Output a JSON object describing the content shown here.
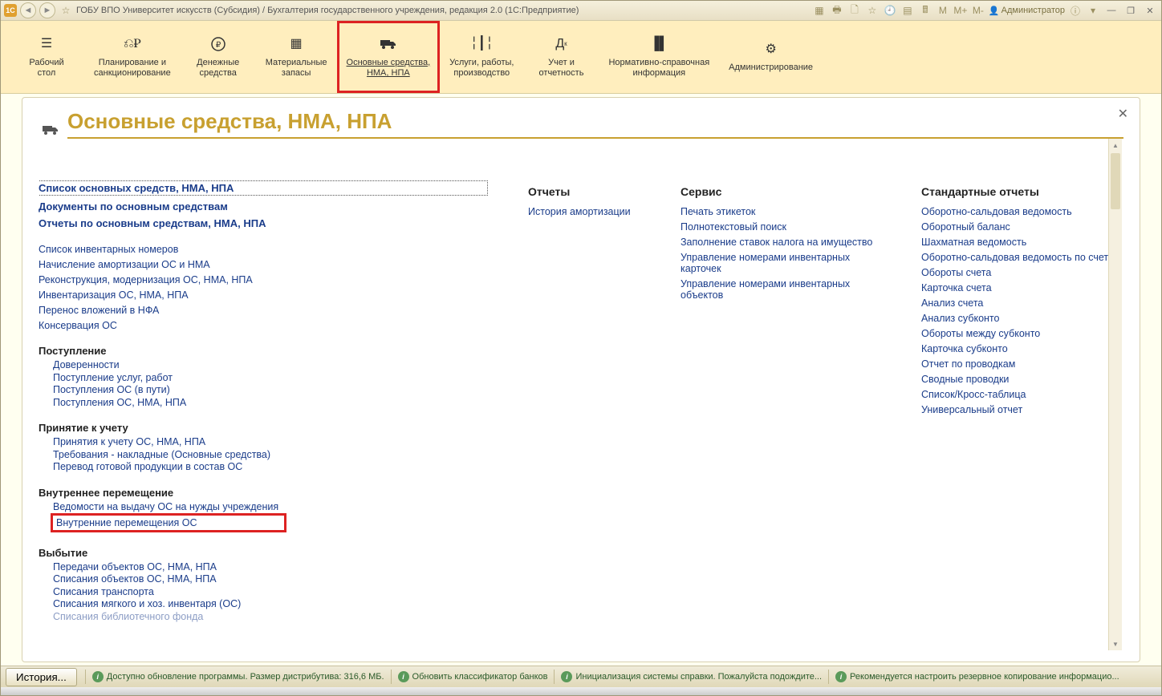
{
  "titlebar": {
    "app_badge": "1C",
    "title": "ГОБУ ВПО Университет искусств (Субсидия) / Бухгалтерия государственного учреждения, редакция 2.0  (1С:Предприятие)",
    "m_labels": [
      "M",
      "M+",
      "M-"
    ],
    "user": "Администратор"
  },
  "nav": {
    "items": [
      {
        "label": "Рабочий\nстол"
      },
      {
        "label": "Планирование и\nсанкционирование"
      },
      {
        "label": "Денежные\nсредства"
      },
      {
        "label": "Материальные\nзапасы"
      },
      {
        "label": "Основные средства,\nНМА, НПА",
        "highlighted": true
      },
      {
        "label": "Услуги, работы,\nпроизводство"
      },
      {
        "label": "Учет и\nотчетность"
      },
      {
        "label": "Нормативно-справочная\nинформация"
      },
      {
        "label": "Администрирование"
      }
    ]
  },
  "page": {
    "title": "Основные средства, НМА, НПА"
  },
  "left_col": {
    "top_links": [
      "Список основных средств, НМА, НПА",
      "Документы по основным средствам",
      "Отчеты по основным средствам, НМА, НПА"
    ],
    "misc_links": [
      "Список инвентарных номеров",
      "Начисление амортизации ОС и НМА",
      "Реконструкция, модернизация ОС, НМА, НПА",
      "Инвентаризация ОС, НМА, НПА",
      "Перенос вложений в НФА",
      "Консервация ОС"
    ],
    "groups": [
      {
        "title": "Поступление",
        "items": [
          "Доверенности",
          "Поступление услуг, работ",
          "Поступления ОС (в пути)",
          "Поступления ОС, НМА, НПА"
        ]
      },
      {
        "title": "Принятие к учету",
        "items": [
          "Принятия к учету ОС, НМА, НПА",
          "Требования - накладные (Основные средства)",
          "Перевод готовой продукции в состав ОС"
        ]
      },
      {
        "title": "Внутреннее перемещение",
        "items": [
          "Ведомости на выдачу ОС на нужды учреждения",
          "Внутренние перемещения ОС"
        ]
      },
      {
        "title": "Выбытие",
        "items": [
          "Передачи объектов ОС, НМА, НПА",
          "Списания объектов ОС, НМА, НПА",
          "Списания транспорта",
          "Списания мягкого и хоз. инвентаря (ОС)",
          "Списания библиотечного фонда"
        ]
      }
    ]
  },
  "col2": {
    "head": "Отчеты",
    "items": [
      "История амортизации"
    ]
  },
  "col3": {
    "head": "Сервис",
    "items": [
      "Печать этикеток",
      "Полнотекстовый поиск",
      "Заполнение ставок налога на имущество",
      "Управление номерами инвентарных карточек",
      "Управление номерами инвентарных объектов"
    ]
  },
  "col4": {
    "head": "Стандартные отчеты",
    "items": [
      "Оборотно-сальдовая ведомость",
      "Оборотный баланс",
      "Шахматная ведомость",
      "Оборотно-сальдовая ведомость по счету",
      "Обороты счета",
      "Карточка счета",
      "Анализ счета",
      "Анализ субконто",
      "Обороты между субконто",
      "Карточка субконто",
      "Отчет по проводкам",
      "Сводные проводки",
      "Список/Кросс-таблица",
      "Универсальный отчет"
    ]
  },
  "status": {
    "history": "История...",
    "items": [
      "Доступно обновление программы. Размер дистрибутива: 316,6 МБ.",
      "Обновить классификатор банков",
      "Инициализация системы справки. Пожалуйста подождите...",
      "Рекомендуется настроить резервное копирование информацио..."
    ]
  }
}
